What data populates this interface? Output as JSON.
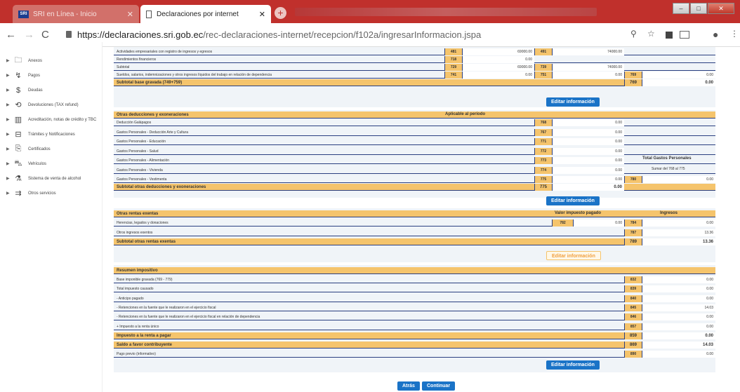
{
  "browser": {
    "tab1_title": "SRI en Línea - Inicio",
    "tab1_icon": "SRI",
    "tab2_title": "Declaraciones por internet",
    "url_host": "https://declaraciones.sri.gob.ec",
    "url_path": "/rec-declaraciones-internet/recepcion/f102a/ingresarInformacion.jspa"
  },
  "sidebar": {
    "items": [
      "Anexos",
      "Pagos",
      "Deudas",
      "Devoluciones (TAX refund)",
      "Acreditación, notas de crédito y TBC",
      "Trámites y Notificaciones",
      "Certificados",
      "Vehículos",
      "Sistema de venta de alcohol",
      "Otros servicios"
    ]
  },
  "top": {
    "rows": [
      {
        "label": "Actividades empresariales con registro de ingresos y egresos",
        "c1": "481",
        "v1": "69000.00",
        "c2": "491",
        "v2": "74000.00"
      },
      {
        "label": "Rendimientos financieros",
        "c1": "718",
        "v1": "0.00"
      },
      {
        "label": "Subtotal",
        "c1": "729",
        "v1": "69000.00",
        "c2": "739",
        "v2": "74000.00"
      },
      {
        "label": "Sueldos, salarios, indemnizaciones y otros ingresos líquidos del trabajo en relación de dependencia",
        "c1": "741",
        "v1": "0.00",
        "c2": "751",
        "v2": "0.00",
        "c3": "769",
        "v3": "0.00"
      }
    ],
    "subtotal": {
      "label": "Subtotal base gravada (749+759)",
      "code": "769",
      "value": "0.00"
    },
    "edit": "Editar información"
  },
  "deducciones": {
    "header": "Otras deducciones y exoneraciones",
    "col": "Aplicable al período",
    "side_header": "Total Gastos Personales",
    "side_note": "Sumar del 768 al 775",
    "rows": [
      {
        "label": "Deducción Galápagos",
        "code": "768",
        "value": "0.00"
      },
      {
        "label": "Gastos Personales - Deducción Arte y Cultura",
        "code": "767",
        "value": "0.00"
      },
      {
        "label": "Gastos Personales - Educación",
        "code": "771",
        "value": "0.00"
      },
      {
        "label": "Gastos Personales - Salud",
        "code": "772",
        "value": "0.00"
      },
      {
        "label": "Gastos Personales - Alimentación",
        "code": "773",
        "value": "0.00"
      },
      {
        "label": "Gastos Personales - Vivienda",
        "code": "774",
        "value": "0.00"
      },
      {
        "label": "Gastos Personales - Vestimenta",
        "code": "775",
        "value": "0.00",
        "code2": "780",
        "value2": "0.00"
      }
    ],
    "subtotal": {
      "label": "Subtotal otras deducciones y exoneraciones",
      "code": "775",
      "value": "0.00"
    },
    "edit": "Editar información"
  },
  "exentas": {
    "header": "Otras rentas exentas",
    "col1": "Valor impuesto pagado",
    "col2": "Ingresos",
    "rows": [
      {
        "label": "Herencias, legados y donaciones",
        "code": "782",
        "value": "0.00",
        "code2": "784",
        "value2": "0.00"
      },
      {
        "label": "Otros ingresos exentos",
        "code2": "787",
        "value2": "13.36"
      }
    ],
    "subtotal": {
      "label": "Subtotal otras rentas exentas",
      "code": "789",
      "value": "13.36"
    },
    "edit": "Editar información"
  },
  "resumen": {
    "header": "Resumen impositivo",
    "rows": [
      {
        "label": "Base imponible gravada (769 - 779)",
        "code": "832",
        "value": "0.00",
        "bold": false
      },
      {
        "label": "Total impuesto causado",
        "code": "839",
        "value": "0.00",
        "bold": false
      },
      {
        "label": "- Anticipo pagado",
        "code": "840",
        "value": "0.00",
        "bold": false
      },
      {
        "label": "- Retenciones en la fuente que le realizaron en el ejercicio fiscal",
        "code": "845",
        "value": "14.03",
        "bold": false
      },
      {
        "label": "- Retenciones en la fuente que le realizaron en el ejercicio fiscal en relación de dependencia",
        "code": "846",
        "value": "0.00",
        "bold": false
      },
      {
        "label": "+ Impuesto a la renta único",
        "code": "857",
        "value": "0.00",
        "bold": false
      },
      {
        "label": "Impuesto a la renta a pagar",
        "code": "859",
        "value": "0.00",
        "bold": true
      },
      {
        "label": "Saldo a favor contribuyente",
        "code": "869",
        "value": "14.03",
        "bold": true
      },
      {
        "label": "Pago previo (informativo)",
        "code": "890",
        "value": "0.00",
        "bold": false
      }
    ],
    "edit": "Editar información"
  },
  "footer": {
    "back": "Atrás",
    "next": "Continuar"
  }
}
